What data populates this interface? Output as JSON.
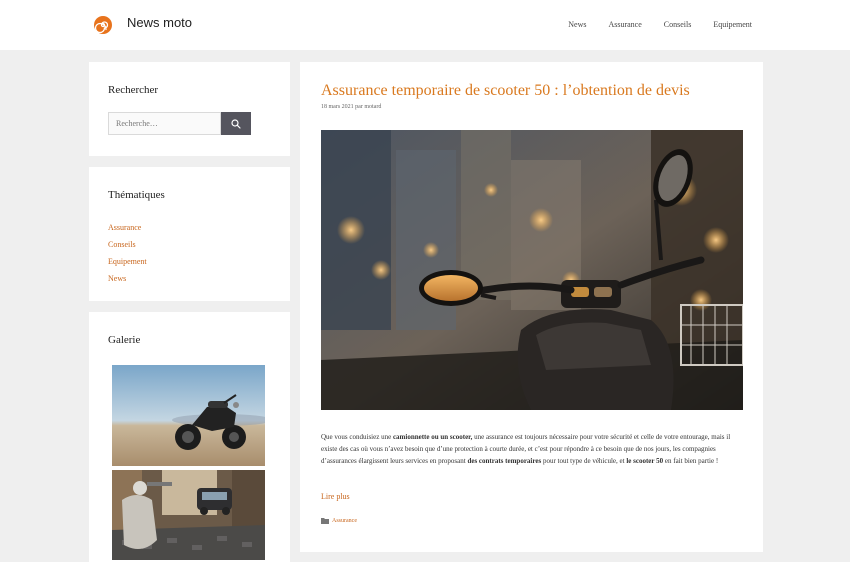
{
  "header": {
    "site_title": "News moto",
    "nav": [
      "News",
      "Assurance",
      "Conseils",
      "Equipement"
    ]
  },
  "sidebar": {
    "search": {
      "title": "Rechercher",
      "placeholder": "Recherche…"
    },
    "themes": {
      "title": "Thématiques",
      "items": [
        "Assurance",
        "Conseils",
        "Equipement",
        "News"
      ]
    },
    "gallery": {
      "title": "Galerie"
    }
  },
  "article": {
    "title": "Assurance temporaire de scooter 50 : l’obtention de devis",
    "meta": "18 mars 2021 par motard",
    "excerpt": {
      "p1": "Que vous conduisiez une ",
      "b1": "camionnette ou un scooter,",
      "p2": " une assurance est toujours nécessaire pour votre sécurité et celle de votre entourage, mais il existe des cas où vous n’avez besoin que d’une protection à courte durée, et c’est pour répondre à ce besoin que de nos jours, les compagnies d’assurances élargissent leurs services en proposant ",
      "b2": "des contrats temporaires",
      "p3": " pour tout type de véhicule, et ",
      "b3": "le scooter 50",
      "p4": " en fait bien partie !"
    },
    "read_more": "Lire plus",
    "category": "Assurance"
  },
  "colors": {
    "accent": "#d9791f",
    "link": "#c8661d",
    "background": "#efefef",
    "search_button": "#55555e"
  }
}
